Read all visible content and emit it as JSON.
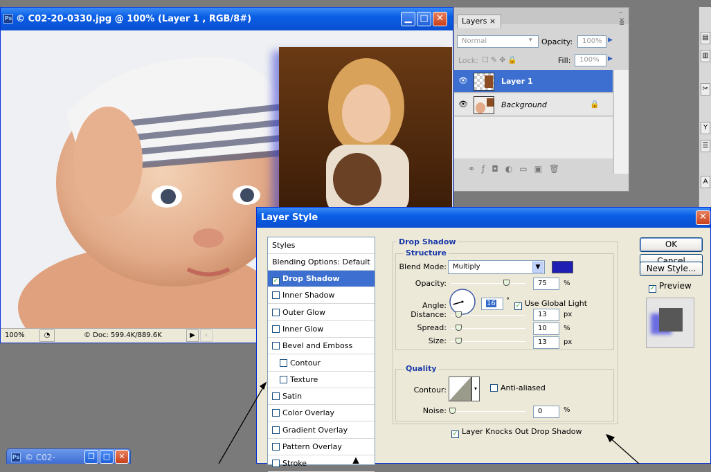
{
  "document": {
    "title": "© C02-20-0330.jpg @ 100% (Layer 1 , RGB/8#)",
    "icon": "photoshop-doc-icon",
    "zoom": "100%",
    "doc_info": "© Doc: 599.4K/889.6K"
  },
  "layers_panel": {
    "tab_label": "Layers ×",
    "blend_mode": "Normal",
    "opacity_label": "Opacity:",
    "opacity_value": "100%",
    "lock_label": "Lock:",
    "fill_label": "Fill:",
    "fill_value": "100%",
    "layers": [
      {
        "name": "Layer 1",
        "selected": true
      },
      {
        "name": "Background",
        "selected": false
      }
    ]
  },
  "minimized_window": {
    "title": "© C02-"
  },
  "layer_style": {
    "title": "Layer Style",
    "styles_header": "Styles",
    "blending_options": "Blending Options: Default",
    "items": [
      {
        "label": "Drop Shadow",
        "checked": true,
        "active": true,
        "indent": false
      },
      {
        "label": "Inner Shadow",
        "checked": false,
        "active": false,
        "indent": false
      },
      {
        "label": "Outer Glow",
        "checked": false,
        "active": false,
        "indent": false
      },
      {
        "label": "Inner Glow",
        "checked": false,
        "active": false,
        "indent": false
      },
      {
        "label": "Bevel and Emboss",
        "checked": false,
        "active": false,
        "indent": false
      },
      {
        "label": "Contour",
        "checked": false,
        "active": false,
        "indent": true
      },
      {
        "label": "Texture",
        "checked": false,
        "active": false,
        "indent": true
      },
      {
        "label": "Satin",
        "checked": false,
        "active": false,
        "indent": false
      },
      {
        "label": "Color Overlay",
        "checked": false,
        "active": false,
        "indent": false
      },
      {
        "label": "Gradient Overlay",
        "checked": false,
        "active": false,
        "indent": false
      },
      {
        "label": "Pattern Overlay",
        "checked": false,
        "active": false,
        "indent": false
      },
      {
        "label": "Stroke",
        "checked": false,
        "active": false,
        "indent": false
      }
    ],
    "drop_shadow": {
      "group_title": "Drop Shadow",
      "structure_title": "Structure",
      "blend_mode_label": "Blend Mode:",
      "blend_mode_value": "Multiply",
      "shadow_color": "#1f1fb4",
      "opacity_label": "Opacity:",
      "opacity_value": "75",
      "opacity_unit": "%",
      "opacity_fraction": 0.75,
      "angle_label": "Angle:",
      "angle_value": "16",
      "angle_unit": "°",
      "use_global_light": "Use Global Light",
      "distance_label": "Distance:",
      "distance_value": "13",
      "distance_unit": "px",
      "spread_label": "Spread:",
      "spread_value": "10",
      "spread_unit": "%",
      "size_label": "Size:",
      "size_value": "13",
      "size_unit": "px",
      "quality_title": "Quality",
      "contour_label": "Contour:",
      "anti_aliased": "Anti-aliased",
      "noise_label": "Noise:",
      "noise_value": "0",
      "noise_unit": "%",
      "knocks_out": "Layer Knocks Out Drop Shadow"
    },
    "buttons": {
      "ok": "OK",
      "cancel": "Cancel",
      "new_style": "New Style...",
      "preview": "Preview"
    }
  }
}
